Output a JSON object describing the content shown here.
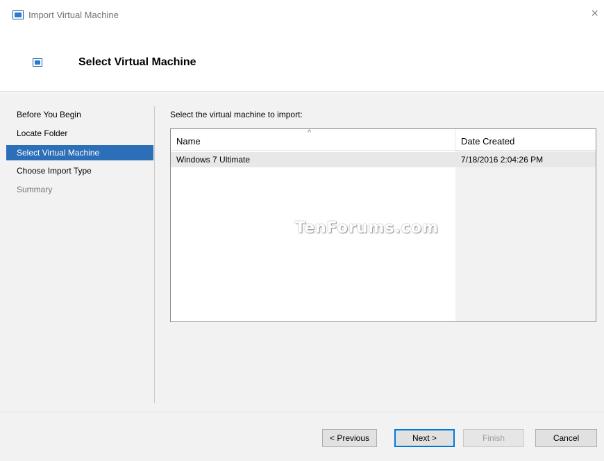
{
  "window": {
    "title": "Import Virtual Machine",
    "close_glyph": "×"
  },
  "header": {
    "title": "Select Virtual Machine"
  },
  "nav": {
    "items": [
      {
        "label": "Before You Begin",
        "state": "normal"
      },
      {
        "label": "Locate Folder",
        "state": "normal"
      },
      {
        "label": "Select Virtual Machine",
        "state": "selected"
      },
      {
        "label": "Choose Import Type",
        "state": "normal"
      },
      {
        "label": "Summary",
        "state": "disabled"
      }
    ]
  },
  "main": {
    "prompt": "Select the virtual machine to import:",
    "list": {
      "columns": [
        "Name",
        "Date Created"
      ],
      "sort_indicator": "^",
      "rows": [
        {
          "name": "Windows 7 Ultimate",
          "date_created": "7/18/2016 2:04:26 PM"
        }
      ]
    }
  },
  "watermark": "TenForums.com",
  "footer": {
    "previous_label": "< Previous",
    "next_label": "Next >",
    "finish_label": "Finish",
    "cancel_label": "Cancel"
  },
  "colors": {
    "selected_nav": "#2c6fb8",
    "default_button_border": "#0078d7",
    "panel_background": "#f2f2f2"
  },
  "icons": {
    "title": "import-vm-icon",
    "header": "import-vm-icon",
    "close": "close-icon"
  }
}
